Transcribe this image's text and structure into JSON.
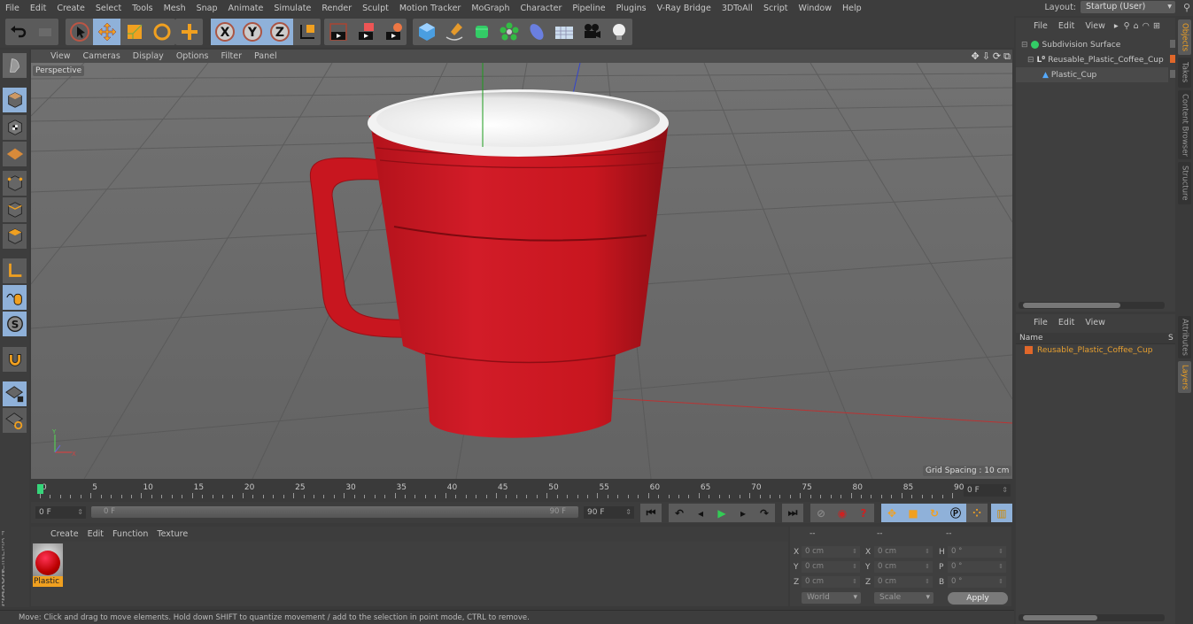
{
  "menu": [
    "File",
    "Edit",
    "Create",
    "Select",
    "Tools",
    "Mesh",
    "Snap",
    "Animate",
    "Simulate",
    "Render",
    "Sculpt",
    "Motion Tracker",
    "MoGraph",
    "Character",
    "Pipeline",
    "Plugins",
    "V-Ray Bridge",
    "3DToAll",
    "Script",
    "Window",
    "Help"
  ],
  "layout": {
    "label": "Layout:",
    "value": "Startup (User)"
  },
  "toolbar": {
    "undo": "undo-icon",
    "redo": "redo-icon",
    "tools": [
      "live-selection",
      "move",
      "scale",
      "rotate",
      "recent-tool"
    ],
    "axes": [
      "X",
      "Y",
      "Z"
    ],
    "coord_system": "world-coordinate-icon",
    "render": [
      "render-view",
      "render-to-picture-viewer",
      "render-settings"
    ],
    "create": [
      "cube",
      "pen-spline",
      "subdivision-surface",
      "cloner",
      "deformer",
      "floor",
      "camera",
      "light"
    ]
  },
  "viewport": {
    "menu": [
      "View",
      "Cameras",
      "Display",
      "Options",
      "Filter",
      "Panel"
    ],
    "camera_label": "Perspective",
    "grid_spacing": "Grid Spacing : 10 cm",
    "accent_colors": {
      "mug_red": "#c8161f",
      "rim_white": "#ededed",
      "grid_bg": "#6b6b6b"
    }
  },
  "timeline": {
    "ticks": [
      "0",
      "5",
      "10",
      "15",
      "20",
      "25",
      "30",
      "35",
      "40",
      "45",
      "50",
      "55",
      "60",
      "65",
      "70",
      "75",
      "80",
      "85",
      "90"
    ],
    "current_frame": "0 F",
    "start_field": "0 F",
    "range_start": "0 F",
    "range_end": "90 F",
    "end_field": "90 F"
  },
  "materials": {
    "menu": [
      "Create",
      "Edit",
      "Function",
      "Texture"
    ],
    "items": [
      {
        "name": "Plastic"
      }
    ]
  },
  "brand": {
    "maxon": "MAXON",
    "product": "CINEMA 4D"
  },
  "coordinates": {
    "headers": [
      "--",
      "--",
      "--"
    ],
    "rows": [
      {
        "l1": "X",
        "v1": "0 cm",
        "l2": "X",
        "v2": "0 cm",
        "l3": "H",
        "v3": "0 °"
      },
      {
        "l1": "Y",
        "v1": "0 cm",
        "l2": "Y",
        "v2": "0 cm",
        "l3": "P",
        "v3": "0 °"
      },
      {
        "l1": "Z",
        "v1": "0 cm",
        "l2": "Z",
        "v2": "0 cm",
        "l3": "B",
        "v3": "0 °"
      }
    ],
    "mode": "World",
    "transform": "Scale",
    "apply": "Apply"
  },
  "status": "Move: Click and drag to move elements. Hold down SHIFT to quantize movement / add to the selection in point mode, CTRL to remove.",
  "objects": {
    "menu": [
      "File",
      "Edit",
      "View"
    ],
    "items": [
      {
        "name": "Subdivision Surface",
        "icon": "subdivision-surface-icon"
      },
      {
        "name": "Reusable_Plastic_Coffee_Cup",
        "icon": "null-object-icon"
      },
      {
        "name": "Plastic_Cup",
        "icon": "polygon-object-icon"
      }
    ]
  },
  "layers": {
    "menu": [
      "File",
      "Edit",
      "View"
    ],
    "col_name": "Name",
    "col_s": "S",
    "items": [
      {
        "name": "Reusable_Plastic_Coffee_Cup",
        "color": "#e0672a"
      }
    ]
  },
  "side_tabs": [
    "Objects",
    "Takes",
    "Content Browser",
    "Structure",
    "Attributes",
    "Layers"
  ]
}
